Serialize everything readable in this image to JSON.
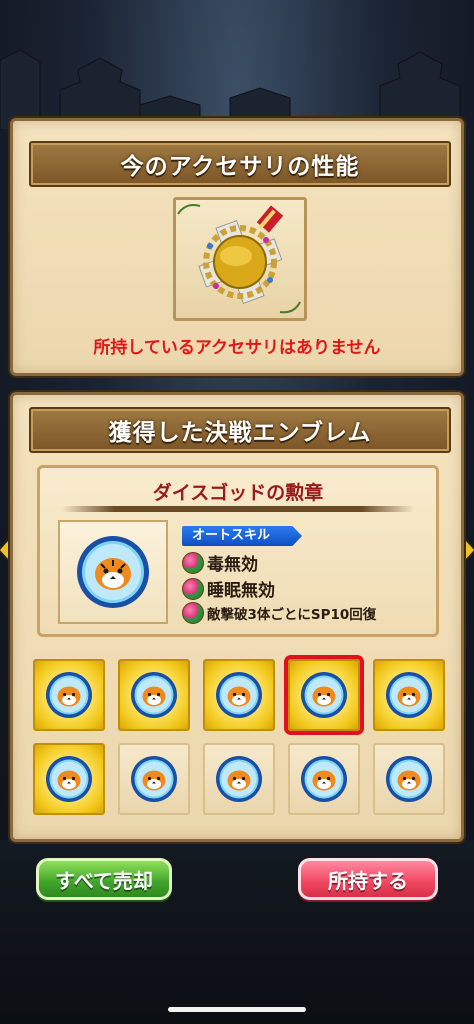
{
  "accessory_panel": {
    "title": "今のアクセサリの性能",
    "status_text": "所持しているアクセサリはありません",
    "status_color": "#e01818"
  },
  "emblem_panel": {
    "title": "獲得した決戦エンブレム",
    "selected": {
      "name": "ダイスゴッドの勲章",
      "skill_badge": "オートスキル",
      "skills": [
        "毒無効",
        "睡眠無効",
        "敵撃破3体ごとにSP10回復"
      ]
    },
    "grid": [
      {
        "style": "gold",
        "selected": false,
        "icon": "tiger-emblem-icon"
      },
      {
        "style": "gold",
        "selected": false,
        "icon": "tiger-emblem-icon"
      },
      {
        "style": "gold",
        "selected": false,
        "icon": "tiger-emblem-icon"
      },
      {
        "style": "gold",
        "selected": true,
        "icon": "tiger-emblem-icon"
      },
      {
        "style": "gold",
        "selected": false,
        "icon": "tiger-emblem-icon"
      },
      {
        "style": "gold",
        "selected": false,
        "icon": "tiger-emblem-icon"
      },
      {
        "style": "plain",
        "selected": false,
        "icon": "tiger-emblem-icon"
      },
      {
        "style": "plain",
        "selected": false,
        "icon": "tiger-emblem-icon"
      },
      {
        "style": "plain",
        "selected": false,
        "icon": "tiger-emblem-icon"
      },
      {
        "style": "plain",
        "selected": false,
        "icon": "tiger-emblem-icon"
      }
    ]
  },
  "buttons": {
    "sell_all": "すべて売却",
    "own": "所持する"
  },
  "colors": {
    "selection_border": "#e0101e",
    "sell_button": "#3fa32a",
    "own_button": "#f0465f",
    "banner": "#7b5527"
  }
}
